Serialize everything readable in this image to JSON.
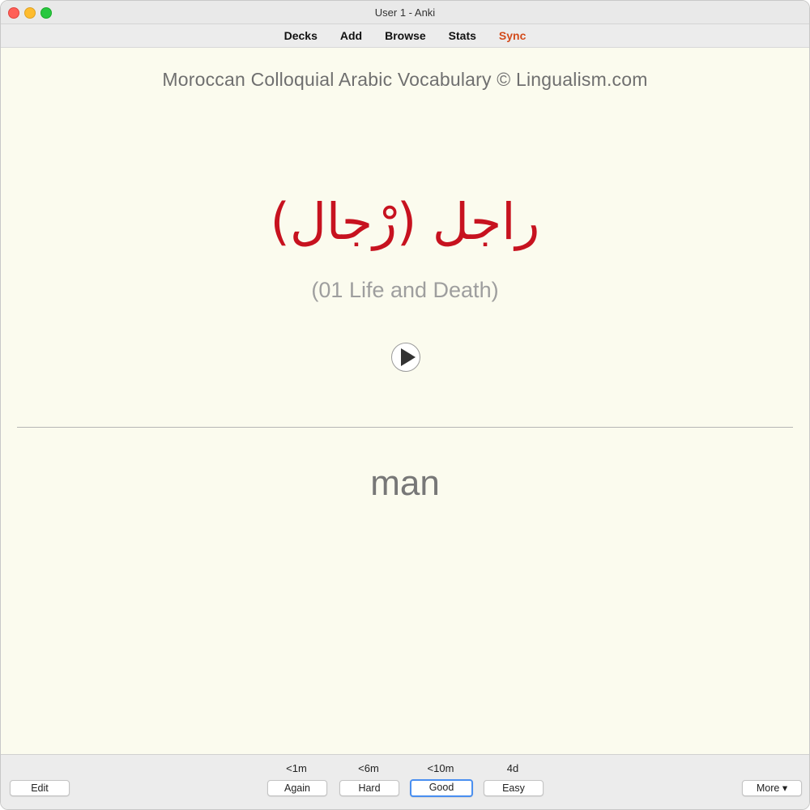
{
  "window": {
    "title": "User 1 - Anki"
  },
  "toolbar": {
    "items": [
      {
        "label": "Decks"
      },
      {
        "label": "Add"
      },
      {
        "label": "Browse"
      },
      {
        "label": "Stats"
      },
      {
        "label": "Sync"
      }
    ],
    "sync_color": "#d24a1a"
  },
  "card": {
    "deck_credit": "Moroccan Colloquial Arabic Vocabulary © Lingualism.com",
    "arabic_word": "راجل (رْجال)",
    "category": "(01 Life and Death)",
    "play_icon": "play-icon",
    "answer": "man",
    "word_color": "#c7121f",
    "background_color": "#fbfbee"
  },
  "bottom": {
    "edit_label": "Edit",
    "more_label": "More ▾",
    "answers": [
      {
        "interval": "<1m",
        "label": "Again"
      },
      {
        "interval": "<6m",
        "label": "Hard"
      },
      {
        "interval": "<10m",
        "label": "Good"
      },
      {
        "interval": "4d",
        "label": "Easy"
      }
    ]
  }
}
